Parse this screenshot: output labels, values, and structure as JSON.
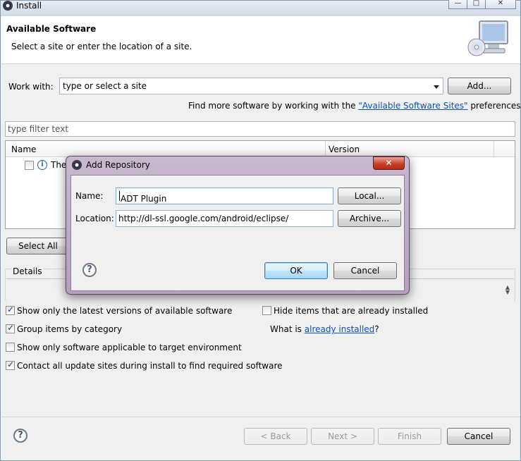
{
  "window": {
    "title": "Install",
    "controls": [
      "—",
      "□",
      "✕"
    ]
  },
  "header": {
    "title": "Available Software",
    "subtitle": "Select a site or enter the location of a site.",
    "icon": "monitor-cd-icon"
  },
  "work_with": {
    "label": "Work with:",
    "value": "type or select a site",
    "add_label": "Add..."
  },
  "more_software": {
    "prefix": "Find more software by working with the ",
    "link": "\"Available Software Sites\"",
    "suffix": " preferences."
  },
  "filter": {
    "placeholder": "type filter text"
  },
  "table": {
    "columns": [
      "Name",
      "Version"
    ],
    "rows": [
      {
        "text": "The",
        "checked": false
      }
    ]
  },
  "select_all_label": "Select All",
  "details_label": "Details",
  "options": {
    "latest_versions": {
      "label": "Show only the latest versions of available software",
      "checked": true
    },
    "group_category": {
      "label": "Group items by category",
      "checked": true
    },
    "target_env": {
      "label": "Show only software applicable to target environment",
      "checked": false
    },
    "contact_sites": {
      "label": "Contact all update sites during install to find required software",
      "checked": true
    },
    "hide_installed": {
      "label": "Hide items that are already installed",
      "checked": false
    },
    "what_is": {
      "prefix": "What is ",
      "link": "already installed",
      "suffix": "?"
    }
  },
  "footer": {
    "back": "< Back",
    "next": "Next >",
    "finish": "Finish",
    "cancel": "Cancel"
  },
  "dialog": {
    "title": "Add Repository",
    "close": "✕",
    "name_label": "Name:",
    "name_value": "ADT Plugin",
    "local_label": "Local...",
    "location_label": "Location:",
    "location_value": "http://dl-ssl.google.com/android/eclipse/",
    "archive_label": "Archive...",
    "ok": "OK",
    "cancel": "Cancel"
  },
  "help_glyph": "?",
  "info_glyph": "i",
  "colors": {
    "link": "#0b4fc2",
    "dialog_frame": "#b59fbc",
    "close_button": "#c8412b"
  }
}
